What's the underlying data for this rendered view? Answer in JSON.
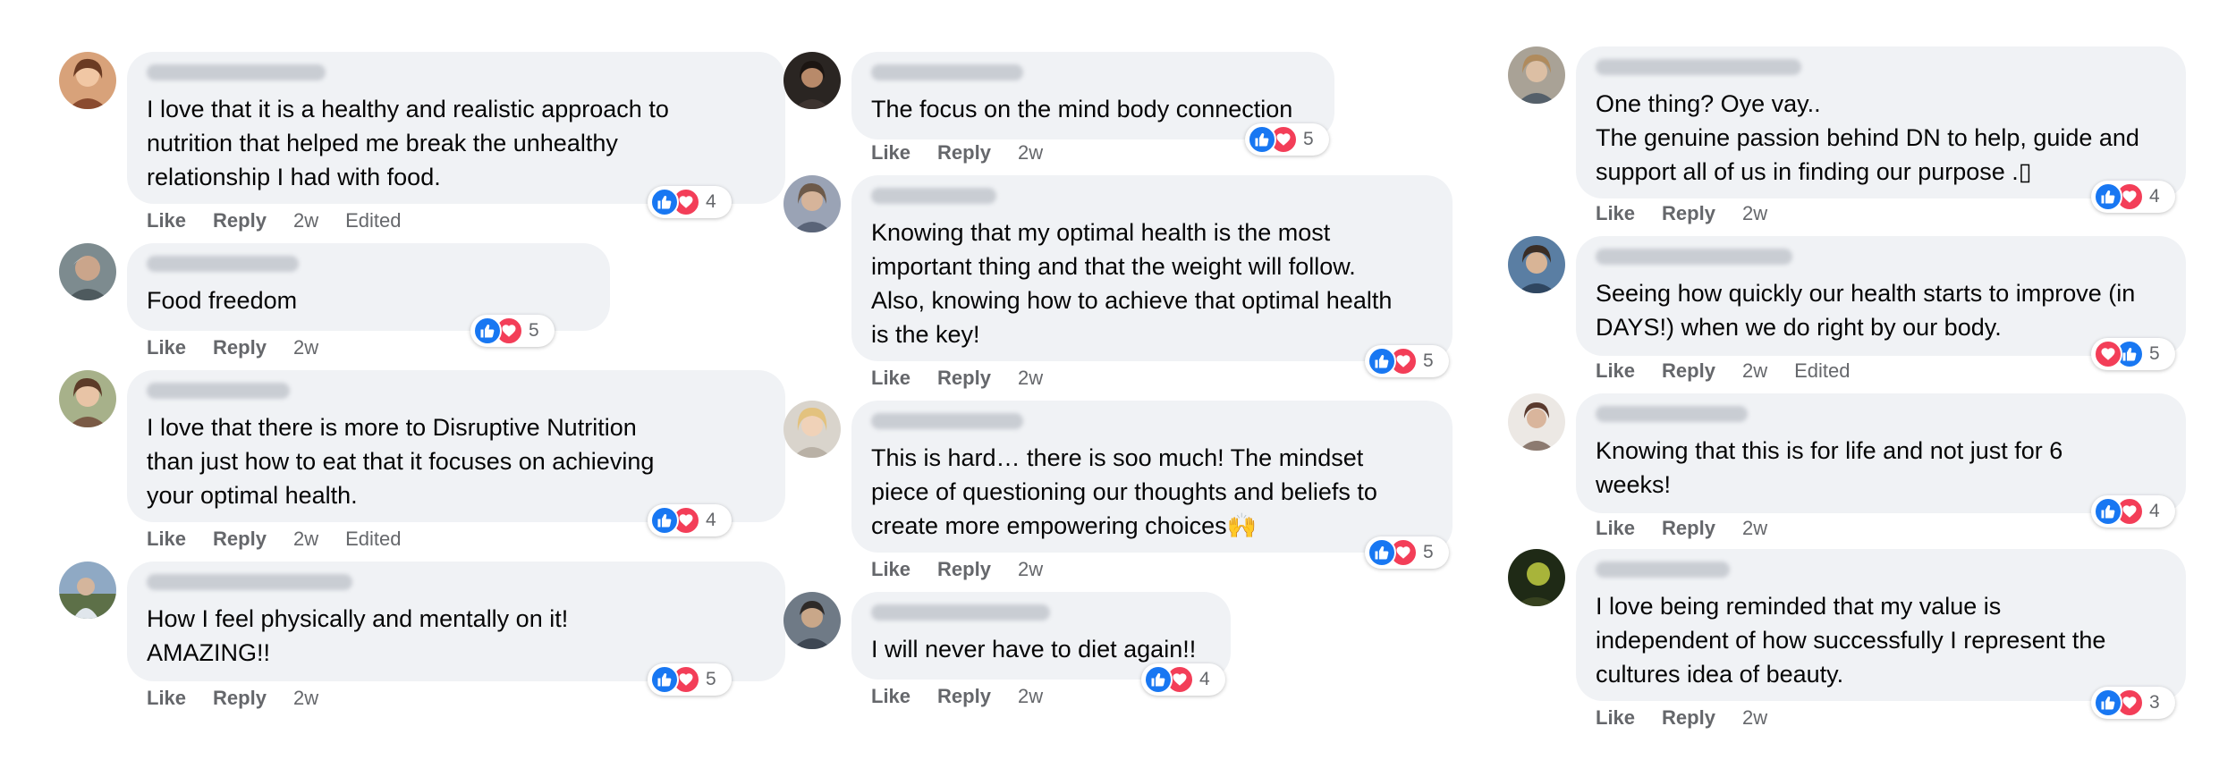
{
  "columns": [
    {
      "comments": [
        {
          "text": "I love that it is a healthy and realistic approach to\nnutrition that helped me break the unhealthy\nrelationship I had with food.",
          "time": "2w",
          "edited": "Edited",
          "reaction_count": "4"
        },
        {
          "text": "Food freedom",
          "time": "2w",
          "edited": "",
          "reaction_count": "5"
        },
        {
          "text": "I love that there is more to Disruptive Nutrition\nthan just how to eat that it focuses on achieving\nyour optimal health.",
          "time": "2w",
          "edited": "Edited",
          "reaction_count": "4"
        },
        {
          "text": "How I feel physically and mentally on it!\nAMAZING!!",
          "time": "2w",
          "edited": "",
          "reaction_count": "5"
        }
      ]
    },
    {
      "comments": [
        {
          "text": "The focus on the mind body connection",
          "time": "2w",
          "edited": "",
          "reaction_count": "5"
        },
        {
          "text": "Knowing that my optimal health is the most\nimportant thing and that the weight will follow.\nAlso, knowing how to achieve that optimal health\nis the key!",
          "time": "2w",
          "edited": "",
          "reaction_count": "5"
        },
        {
          "text": "This is hard… there is soo much! The mindset\npiece of questioning our thoughts and beliefs to\ncreate more empowering choices🙌",
          "time": "2w",
          "edited": "",
          "reaction_count": "5"
        },
        {
          "text": "I will never have to diet again!!",
          "time": "2w",
          "edited": "",
          "reaction_count": "4"
        }
      ]
    },
    {
      "comments": [
        {
          "text": "One thing? Oye vay..\nThe genuine passion behind DN to help, guide and\nsupport all of us in finding our purpose .▯",
          "time": "2w",
          "edited": "",
          "reaction_count": "4"
        },
        {
          "text": "Seeing how quickly our health starts to improve (in\nDAYS!) when we do right by our body.",
          "time": "2w",
          "edited": "Edited",
          "reaction_count": "5"
        },
        {
          "text": "Knowing that this is for life and not just for 6\nweeks!",
          "time": "2w",
          "edited": "",
          "reaction_count": "4"
        },
        {
          "text": "I love being reminded that my value is\nindependent of how successfully I represent the\ncultures idea of beauty.",
          "time": "2w",
          "edited": "",
          "reaction_count": "3"
        }
      ]
    }
  ],
  "labels": {
    "like": "Like",
    "reply": "Reply"
  },
  "icons": {
    "like": "thumbs-up-icon",
    "love": "heart-icon"
  },
  "colors": {
    "like": "#1877f2",
    "love": "#f33e58",
    "bubble": "#f0f2f5",
    "meta": "#65676b"
  }
}
